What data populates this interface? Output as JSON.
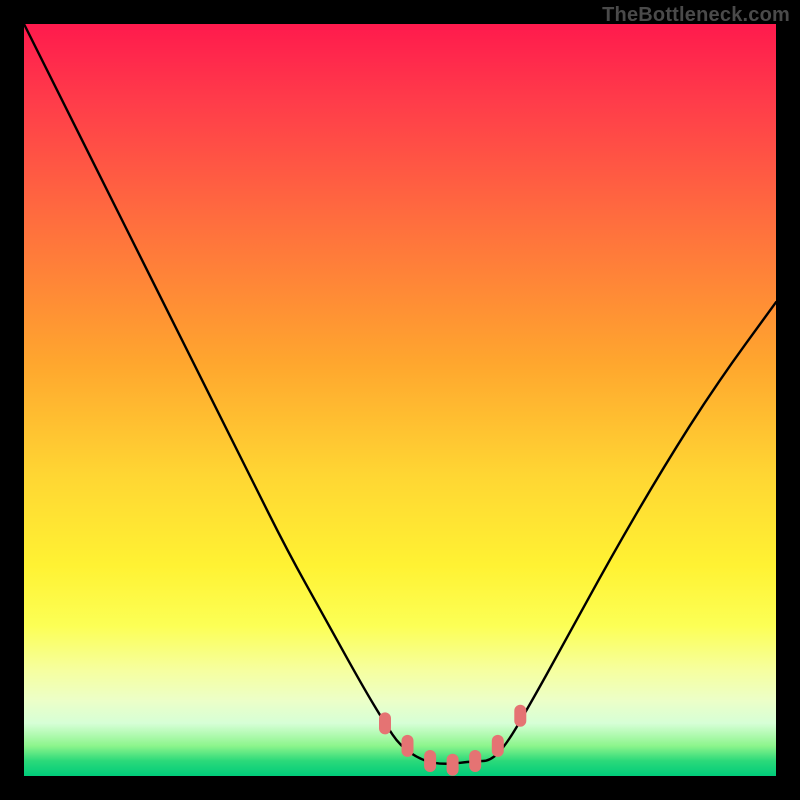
{
  "watermark": "TheBottleneck.com",
  "chart_data": {
    "type": "line",
    "title": "",
    "xlabel": "",
    "ylabel": "",
    "xlim": [
      0,
      100
    ],
    "ylim": [
      0,
      100
    ],
    "series": [
      {
        "name": "bottleneck-curve",
        "x": [
          0,
          5,
          10,
          15,
          20,
          25,
          30,
          35,
          40,
          45,
          48,
          50,
          53,
          56,
          60,
          62,
          64,
          67,
          72,
          78,
          85,
          92,
          100
        ],
        "values": [
          100,
          90,
          80,
          70,
          60,
          50,
          40,
          30,
          21,
          12,
          7,
          4,
          2,
          1.5,
          2,
          2,
          4,
          9,
          18,
          29,
          41,
          52,
          63
        ]
      }
    ],
    "annotations": [
      {
        "name": "marker-left-upper",
        "x": 48,
        "y": 7
      },
      {
        "name": "marker-left-lower",
        "x": 51,
        "y": 4
      },
      {
        "name": "marker-trough-1",
        "x": 54,
        "y": 2
      },
      {
        "name": "marker-trough-2",
        "x": 57,
        "y": 1.5
      },
      {
        "name": "marker-trough-3",
        "x": 60,
        "y": 2
      },
      {
        "name": "marker-right-lower",
        "x": 63,
        "y": 4
      },
      {
        "name": "marker-right-upper",
        "x": 66,
        "y": 8
      }
    ],
    "colors": {
      "curve": "#000000",
      "markers": "#e57373",
      "gradient_top": "#ff1a4d",
      "gradient_mid": "#ffd633",
      "gradient_bottom": "#00cc7a"
    }
  }
}
